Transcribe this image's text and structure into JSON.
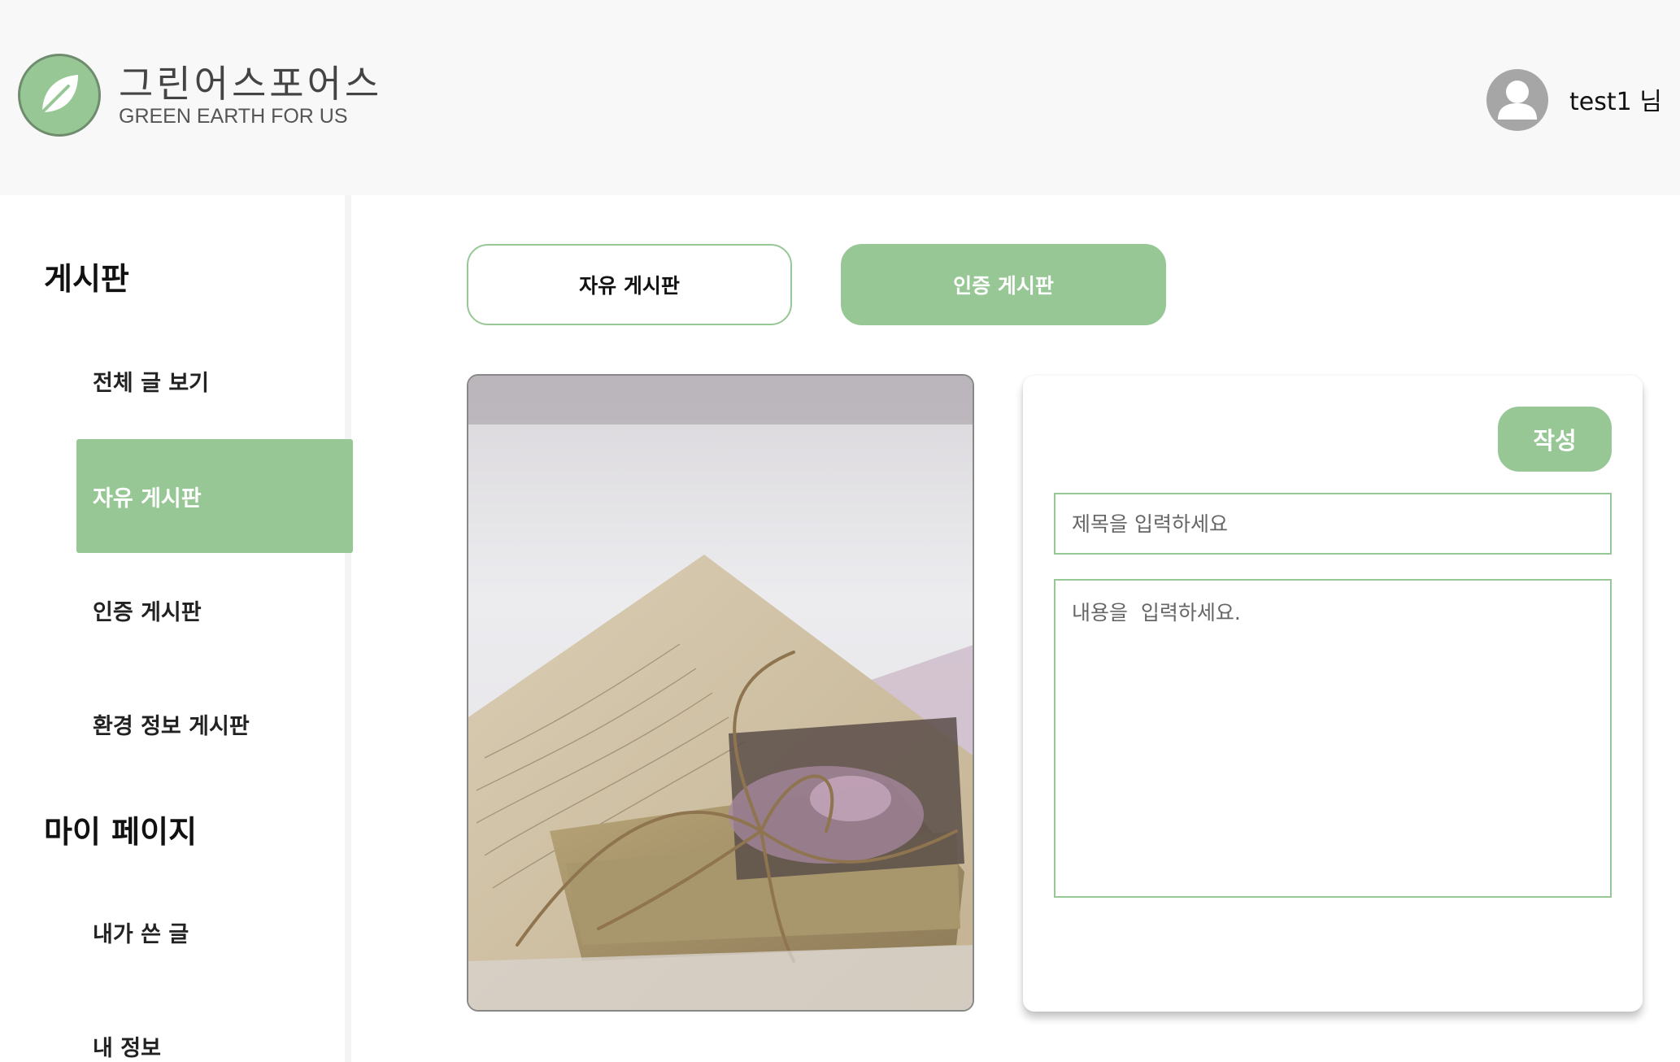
{
  "header": {
    "logo_title": "그린어스포어스",
    "logo_subtitle": "GREEN EARTH FOR US",
    "username": "test1 님"
  },
  "sidebar": {
    "board_section": "게시판",
    "board_items": [
      {
        "label": "전체 글 보기",
        "active": false
      },
      {
        "label": "자유 게시판",
        "active": true
      },
      {
        "label": "인증 게시판",
        "active": false
      },
      {
        "label": "환경 정보 게시판",
        "active": false
      }
    ],
    "mypage_section": "마이 페이지",
    "mypage_items": [
      {
        "label": "내가 쓴 글"
      },
      {
        "label": "내 정보"
      }
    ]
  },
  "tabs": {
    "free": "자유 게시판",
    "cert": "인증 게시판",
    "active": "cert"
  },
  "editor": {
    "submit_label": "작성",
    "title_placeholder": "제목을 입력하세요",
    "content_placeholder": "내용을  입력하세요."
  },
  "colors": {
    "accent": "#97c795",
    "header_bg": "#f8f8f8",
    "avatar": "#a6a6a6"
  },
  "icons": {
    "logo": "leaf-icon",
    "avatar": "user-icon"
  }
}
